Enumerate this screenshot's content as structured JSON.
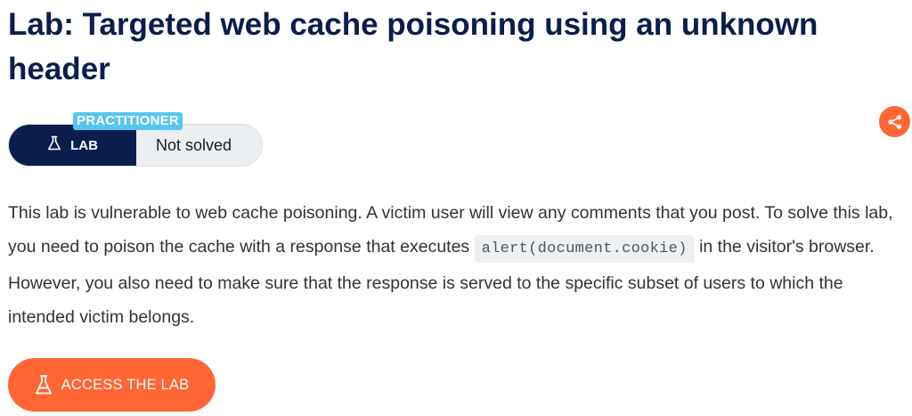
{
  "lab": {
    "title": "Lab: Targeted web cache poisoning using an unknown header",
    "level": "PRACTITIONER",
    "badge_label": "LAB",
    "status": "Not solved"
  },
  "description": {
    "part1": "This lab is vulnerable to web cache poisoning. A victim user will view any comments that you post. To solve this lab, you need to poison the cache with a response that executes ",
    "code": "alert(document.cookie)",
    "part2": " in the visitor's browser. However, you also need to make sure that the response is served to the specific subset of users to which the intended victim belongs."
  },
  "actions": {
    "access_label": "ACCESS THE LAB"
  },
  "icons": {
    "badge_icon": "flask-icon",
    "share_icon": "share-icon",
    "access_icon": "flask-icon"
  },
  "colors": {
    "title": "#0a1d4d",
    "badge_dark": "#0a1d4d",
    "level_tag": "#56c6f0",
    "accent": "#ff6633",
    "status_bg": "#eceff2",
    "code_bg": "#eef1f4"
  }
}
